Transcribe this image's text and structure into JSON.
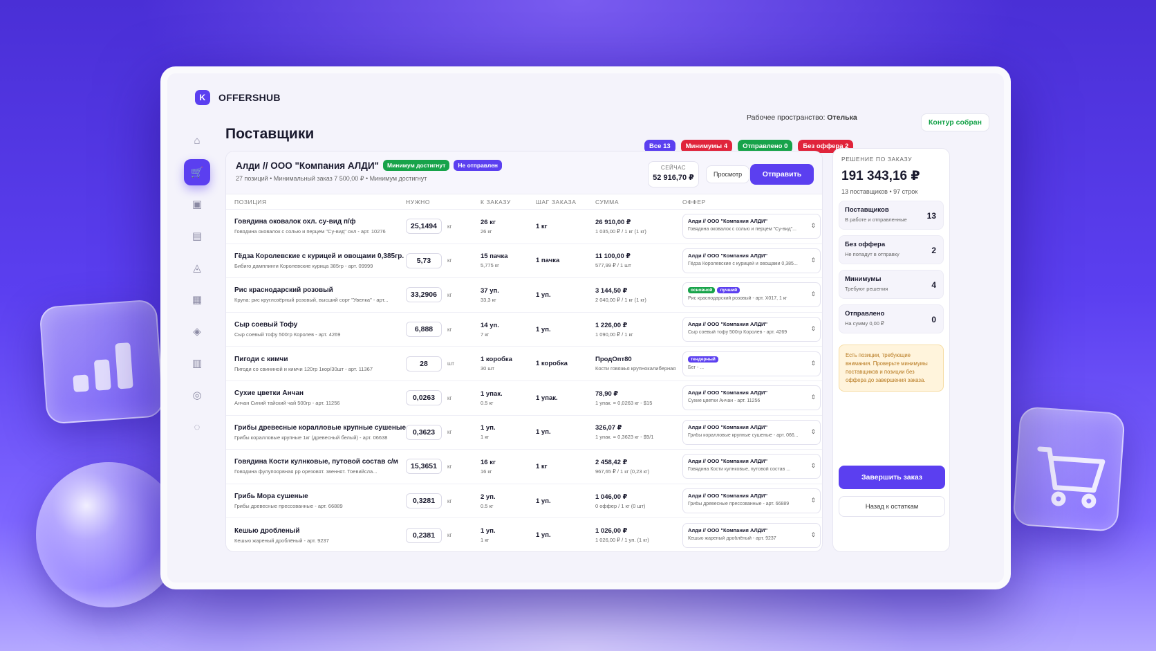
{
  "colors": {
    "accent": "#5b3ff0",
    "success": "#17a34a",
    "danger": "#e0243b",
    "warning": "#f6dca3"
  },
  "app": {
    "name": "OFFERSHUB",
    "logo_glyph": "K"
  },
  "nav": [
    {
      "icon": "store-icon",
      "glyph": "⌂"
    },
    {
      "icon": "cart-icon",
      "glyph": "🛒",
      "active": true
    },
    {
      "icon": "box-icon",
      "glyph": "▣"
    },
    {
      "icon": "truck-icon",
      "glyph": "▤"
    },
    {
      "icon": "bell-icon",
      "glyph": "◬"
    },
    {
      "icon": "report-icon",
      "glyph": "▦"
    },
    {
      "icon": "users-icon",
      "glyph": "◈"
    },
    {
      "icon": "book-icon",
      "glyph": "▥"
    },
    {
      "icon": "settings-icon",
      "glyph": "◎"
    },
    {
      "icon": "support-icon",
      "glyph": "◌"
    }
  ],
  "header": {
    "workspace_label": "Рабочее пространство:",
    "workspace_name": "Отелька",
    "contour_status": "Контур собран",
    "title": "Поставщики"
  },
  "filters": [
    {
      "label": "Все 13",
      "color": "purple"
    },
    {
      "label": "Минимумы 4",
      "color": "red"
    },
    {
      "label": "Отправлено 0",
      "color": "green"
    },
    {
      "label": "Без оффера 2",
      "color": "red"
    }
  ],
  "supplier": {
    "name": "Алди // ООО \"Компания АЛДИ\"",
    "badge_min": "Минимум достигнут",
    "badge_status": "Не отправлен",
    "meta": "27 позиций  •  Минимальный заказ 7 500,00 ₽  •  Минимум достигнут",
    "now_label": "СЕЙЧАС",
    "now_value": "52 916,70 ₽",
    "preview_label": "Просмотр",
    "send_label": "Отправить"
  },
  "columns": [
    "ПОЗИЦИЯ",
    "НУЖНО",
    "К ЗАКАЗУ",
    "ШАГ ЗАКАЗА",
    "СУММА",
    "ОФФЕР"
  ],
  "rows": [
    {
      "name": "Говядина оковалок охл. су-вид п/ф",
      "desc": "Говядина оковалок с солью и перцем \"Су-вид\" охл - арт. 10276",
      "need": "25,1494",
      "unit": "кг",
      "order": "26 кг",
      "order_sub": "26 кг",
      "step": "1 кг",
      "sum": "26 910,00 ₽",
      "sum_sub": "1 035,00 ₽ / 1 кг (1 кг)",
      "offer": "Алди // ООО \"Компания АЛДИ\"",
      "offer_sub": "Говядина оковалок с солью и перцем \"Су-вид\"...",
      "tags": []
    },
    {
      "name": "Гёдза Королевские с курицей и овощами 0,385гр.",
      "desc": "Бибиго дамплинги Королевские курица 385гр - арт. 09999",
      "need": "5,73",
      "unit": "кг",
      "order": "15 пачка",
      "order_sub": "5,775 кг",
      "step": "1 пачка",
      "sum": "11 100,00 ₽",
      "sum_sub": "577,99 ₽ / 1 шт",
      "offer": "Алди // ООО \"Компания АЛДИ\"",
      "offer_sub": "Гёдза Королевские с курицей и овощами 0,385...",
      "tags": []
    },
    {
      "name": "Рис краснодарский розовый",
      "desc": "Крупа: рис круглозёрный розовый, высший сорт \"Увелка\" - арт...",
      "need": "33,2906",
      "unit": "кг",
      "order": "37 уп.",
      "order_sub": "33,3 кг",
      "step": "1 уп.",
      "sum": "3 144,50 ₽",
      "sum_sub": "2 040,00 ₽ / 1 кг (1 кг)",
      "offer": "",
      "offer_sub": "Рис краснодарский розовый - арт. Х017, 1 кг",
      "tags": [
        {
          "label": "основной",
          "color": "green"
        },
        {
          "label": "лучший",
          "color": "purple"
        }
      ]
    },
    {
      "name": "Сыр соевый Тофу",
      "desc": "Сыр соевый тофу 500гр Королев - арт. 4269",
      "need": "6,888",
      "unit": "кг",
      "order": "14 уп.",
      "order_sub": "7 кг",
      "step": "1 уп.",
      "sum": "1 226,00 ₽",
      "sum_sub": "1 090,00 ₽ / 1 кг",
      "offer": "Алди // ООО \"Компания АЛДИ\"",
      "offer_sub": "Сыр соевый тофу 500гр Королев - арт. 4269",
      "tags": []
    },
    {
      "name": "Пигоди с кимчи",
      "desc": "Пигоди со свининой и кимчи 120гр 1кор/30шт - арт. 11367",
      "need": "28",
      "unit": "шт",
      "order": "1 коробка",
      "order_sub": "30 шт",
      "step": "1 коробка",
      "sum": "ПродОпт80",
      "sum_sub": "Кости говяжья крупнокалиберная",
      "offer": "",
      "offer_sub": "Бег - ...",
      "tags": [
        {
          "label": "тендерный",
          "color": "purple"
        }
      ]
    },
    {
      "name": "Сухие цветки Анчан",
      "desc": "Анчан Синий тайский чай 500гр - арт. 11256",
      "need": "0,0263",
      "unit": "кг",
      "order": "1 упак.",
      "order_sub": "0.5 кг",
      "step": "1 упак.",
      "sum": "78,90 ₽",
      "sum_sub": "1 упак. = 0,0263 кг - $15",
      "offer": "Алди // ООО \"Компания АЛДИ\"",
      "offer_sub": "Сухие цветки Анчан - арт. 11256",
      "tags": []
    },
    {
      "name": "Грибы древесные коралловые крупные сушеные",
      "desc": "Грибы коралловые крупные 1кг (древесный белый) - арт. 06638",
      "need": "0,3623",
      "unit": "кг",
      "order": "1 уп.",
      "order_sub": "1 кг",
      "step": "1 уп.",
      "sum": "326,07 ₽",
      "sum_sub": "1 упак. = 0,3623 кг - $9/1",
      "offer": "Алди // ООО \"Компания АЛДИ\"",
      "offer_sub": "Грибы коралловые крупные сушеные - арт. 066...",
      "tags": []
    },
    {
      "name": "Говядина Кости кулнковые, путовой состав с/м",
      "desc": "Говядина фулупоорвная рр орезовят. звеннят. Тоевийсла...",
      "need": "15,3651",
      "unit": "кг",
      "order": "16 кг",
      "order_sub": "16 кг",
      "step": "1 кг",
      "sum": "2 458,42 ₽",
      "sum_sub": "967,65 ₽ / 1 кг (0,23 кг)",
      "offer": "Алди // ООО \"Компания АЛДИ\"",
      "offer_sub": "Говядина Кости кулнковые, путовой состав ...",
      "tags": []
    },
    {
      "name": "Грибь Мора сушеные",
      "desc": "Грибы древесные прессованные - арт. 66889",
      "need": "0,3281",
      "unit": "кг",
      "order": "2 уп.",
      "order_sub": "0.5 кг",
      "step": "1 уп.",
      "sum": "1 046,00 ₽",
      "sum_sub": "0 оффер / 1 кг (0 шт)",
      "offer": "Алди // ООО \"Компания АЛДИ\"",
      "offer_sub": "Грибы древесные прессованные - арт. 66889",
      "tags": []
    },
    {
      "name": "Кешью дробленый",
      "desc": "Кешью жареный дроблёный - арт. 9237",
      "need": "0,2381",
      "unit": "кг",
      "order": "1 уп.",
      "order_sub": "1 кг",
      "step": "1 уп.",
      "sum": "1 026,00 ₽",
      "sum_sub": "1 026,00 ₽ / 1 уп. (1 кг)",
      "offer": "Алди // ООО \"Компания АЛДИ\"",
      "offer_sub": "Кешью жареный дроблёный - арт. 9237",
      "tags": []
    }
  ],
  "side": {
    "label": "РЕШЕНИЕ ПО ЗАКАЗУ",
    "total": "191 343,16 ₽",
    "sub": "13 поставщиков • 97 строк",
    "stats": [
      {
        "title": "Поставщиков",
        "sub": "В работе и отправленные",
        "value": "13"
      },
      {
        "title": "Без оффера",
        "sub": "Не попадут в отправку",
        "value": "2"
      },
      {
        "title": "Минимумы",
        "sub": "Требуют решения",
        "value": "4"
      },
      {
        "title": "Отправлено",
        "sub": "На сумму 0,00 ₽",
        "value": "0"
      }
    ],
    "warning": "Есть позиции, требующие внимания. Проверьте минимумы поставщиков и позиции без оффера до завершения заказа.",
    "finish_label": "Завершить заказ",
    "back_label": "Назад к остаткам"
  }
}
